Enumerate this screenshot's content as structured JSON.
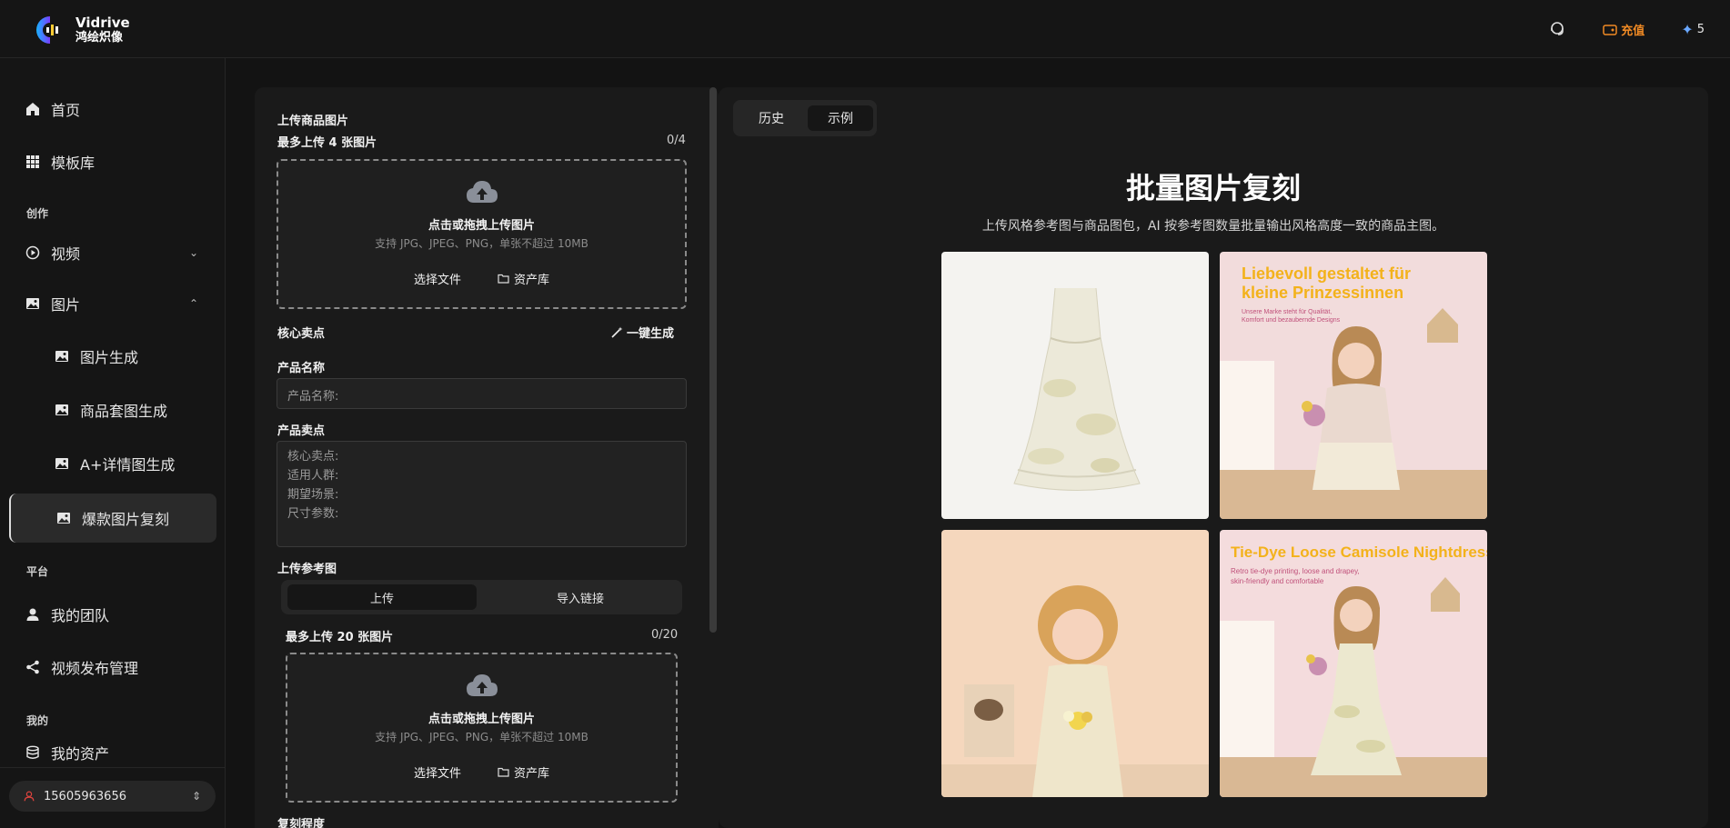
{
  "brand": {
    "name_en": "Vidrive",
    "name_cn": "鸿绘炽像"
  },
  "topbar": {
    "recharge_label": "充值",
    "credits": "5"
  },
  "sidebar": {
    "home": "首页",
    "templates": "模板库",
    "section_create": "创作",
    "video": "视频",
    "image": "图片",
    "image_gen": "图片生成",
    "product_set": "商品套图生成",
    "aplus_detail": "A+详情图生成",
    "hot_copy": "爆款图片复刻",
    "section_platform": "平台",
    "my_team": "我的团队",
    "video_publish": "视频发布管理",
    "section_mine": "我的",
    "my_assets": "我的资产",
    "account_phone": "15605963656"
  },
  "form": {
    "upload_product_title": "上传商品图片",
    "upload_product_limit": "最多上传 4 张图片",
    "upload_product_count": "0/4",
    "dropzone_title": "点击或拖拽上传图片",
    "dropzone_hint": "支持 JPG、JPEG、PNG，单张不超过 10MB",
    "choose_file": "选择文件",
    "asset_library": "资产库",
    "core_selling": "核心卖点",
    "one_click_generate": "一键生成",
    "product_name_label": "产品名称",
    "product_name_placeholder": "产品名称:",
    "selling_points_label": "产品卖点",
    "selling_points_placeholder": "核心卖点:\n适用人群:\n期望场景:\n尺寸参数:",
    "upload_ref_label": "上传参考图",
    "ref_tab_upload": "上传",
    "ref_tab_link": "导入链接",
    "upload_ref_limit": "最多上传 20 张图片",
    "upload_ref_count": "0/20",
    "copy_level_label": "复刻程度"
  },
  "main": {
    "tab_history": "历史",
    "tab_example": "示例",
    "title": "批量图片复刻",
    "subtitle": "上传风格参考图与商品图包，AI 按参考图数量批量输出风格高度一致的商品主图。",
    "images": [
      {
        "alt": "tie-dye camisole dress product shot"
      },
      {
        "alt": "girl in floral blouse",
        "headline": "Liebevoll gestaltet für kleine Prinzessinnen",
        "caption": "Unsere Marke steht für Qualität, Komfort und bezaubernde Designs"
      },
      {
        "alt": "curly-haired girl holding flowers"
      },
      {
        "alt": "girl in tie-dye dress",
        "headline": "Tie-Dye Loose Camisole Nightdress",
        "caption": "Retro tie-dye printing, loose and drapey, skin-friendly and comfortable"
      }
    ]
  },
  "colors": {
    "accent_orange": "#f08a24",
    "accent_blue": "#6aa8ff",
    "headline_yellow": "#f3b21b"
  }
}
